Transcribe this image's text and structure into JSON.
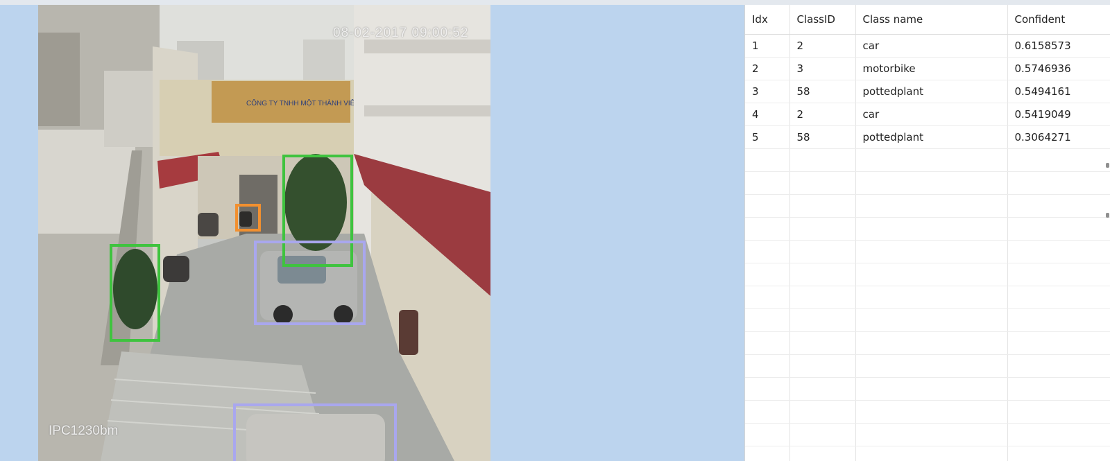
{
  "camera": {
    "timestamp": "08-02-2017 09:00:52",
    "camera_label": "IPC1230bm",
    "building_sign": "CÔNG TY TNHH MỘT THÀNH VIÊN",
    "colors": {
      "potted_plant_box": "#3fc33f",
      "car_box": "#a9a7ee",
      "motorbike_box": "#f2902f"
    }
  },
  "detections_table": {
    "columns": [
      "Idx",
      "ClassID",
      "Class name",
      "Confident"
    ],
    "rows": [
      {
        "idx": "1",
        "class_id": "2",
        "class_name": "car",
        "confidence": "0.6158573"
      },
      {
        "idx": "2",
        "class_id": "3",
        "class_name": "motorbike",
        "confidence": "0.5746936"
      },
      {
        "idx": "3",
        "class_id": "58",
        "class_name": "pottedplant",
        "confidence": "0.5494161"
      },
      {
        "idx": "4",
        "class_id": "2",
        "class_name": "car",
        "confidence": "0.5419049"
      },
      {
        "idx": "5",
        "class_id": "58",
        "class_name": "pottedplant",
        "confidence": "0.3064271"
      }
    ]
  }
}
